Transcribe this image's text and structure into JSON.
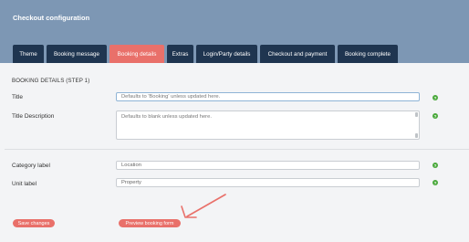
{
  "header": {
    "title": "Checkout configuration"
  },
  "tabs": [
    {
      "label": "Theme",
      "active": false
    },
    {
      "label": "Booking message",
      "active": false
    },
    {
      "label": "Booking details",
      "active": true
    },
    {
      "label": "Extras",
      "active": false
    },
    {
      "label": "Login/Party details",
      "active": false
    },
    {
      "label": "Checkout and payment",
      "active": false
    },
    {
      "label": "Booking complete",
      "active": false
    }
  ],
  "section": {
    "title": "BOOKING DETAILS (STEP 1)"
  },
  "fields": {
    "title": {
      "label": "Title",
      "placeholder": "Defaults to 'Booking' unless updated here."
    },
    "description": {
      "label": "Title Description",
      "placeholder": "Defaults to blank unless updated here."
    },
    "category": {
      "label": "Category label",
      "value": "Location"
    },
    "unit": {
      "label": "Unit label",
      "value": "Property"
    }
  },
  "help_glyph": "?",
  "buttons": {
    "save": "Save changes",
    "preview": "Preview booking form"
  },
  "colors": {
    "header": "#7d97b4",
    "tab": "#1f3550",
    "accent": "#e9706a",
    "help": "#48a83a"
  },
  "icons": {
    "help": "question-icon",
    "annotation": "red-arrow"
  }
}
